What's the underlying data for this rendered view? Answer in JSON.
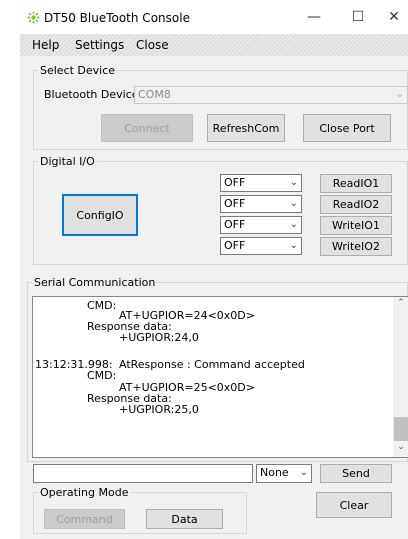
{
  "window": {
    "title": "DT50 BlueTooth Console",
    "controls": {
      "minimize": "—",
      "maximize": "☐",
      "close": "✕"
    }
  },
  "menu": [
    "Help",
    "Settings",
    "Close"
  ],
  "select_device": {
    "legend": "Select Device",
    "bt_label": "Bluetooth Device",
    "bt_value": "COM8",
    "connect": "Connect",
    "refresh": "RefreshCom",
    "close_port": "Close Port"
  },
  "digital_io": {
    "legend": "Digital I/O",
    "config_button": "ConfigIO",
    "rows": [
      {
        "value": "OFF",
        "button": "ReadIO1"
      },
      {
        "value": "OFF",
        "button": "ReadIO2"
      },
      {
        "value": "OFF",
        "button": "WriteIO1"
      },
      {
        "value": "OFF",
        "button": "WriteIO2"
      }
    ]
  },
  "serial": {
    "legend": "Serial Communication",
    "lines": [
      {
        "ts": "",
        "a": "CMD:",
        "b": ""
      },
      {
        "ts": "",
        "a": "",
        "b": "AT+UGPIOR=24<0x0D>"
      },
      {
        "ts": "",
        "a": "Response data:",
        "b": ""
      },
      {
        "ts": "",
        "a": "",
        "b": "+UGPIOR:24,0"
      },
      {
        "ts": "",
        "a": "",
        "b": ""
      },
      {
        "ts": "13:12:31.998:",
        "a": "",
        "b": "AtResponse : Command accepted"
      },
      {
        "ts": "",
        "a": "CMD:",
        "b": ""
      },
      {
        "ts": "",
        "a": "",
        "b": "AT+UGPIOR=25<0x0D>"
      },
      {
        "ts": "",
        "a": "Response data:",
        "b": ""
      },
      {
        "ts": "",
        "a": "",
        "b": "+UGPIOR:25,0"
      }
    ],
    "send_input_value": "",
    "line_ending": "None",
    "send": "Send",
    "clear": "Clear"
  },
  "operating_mode": {
    "legend": "Operating Mode",
    "command": "Command",
    "data": "Data"
  }
}
